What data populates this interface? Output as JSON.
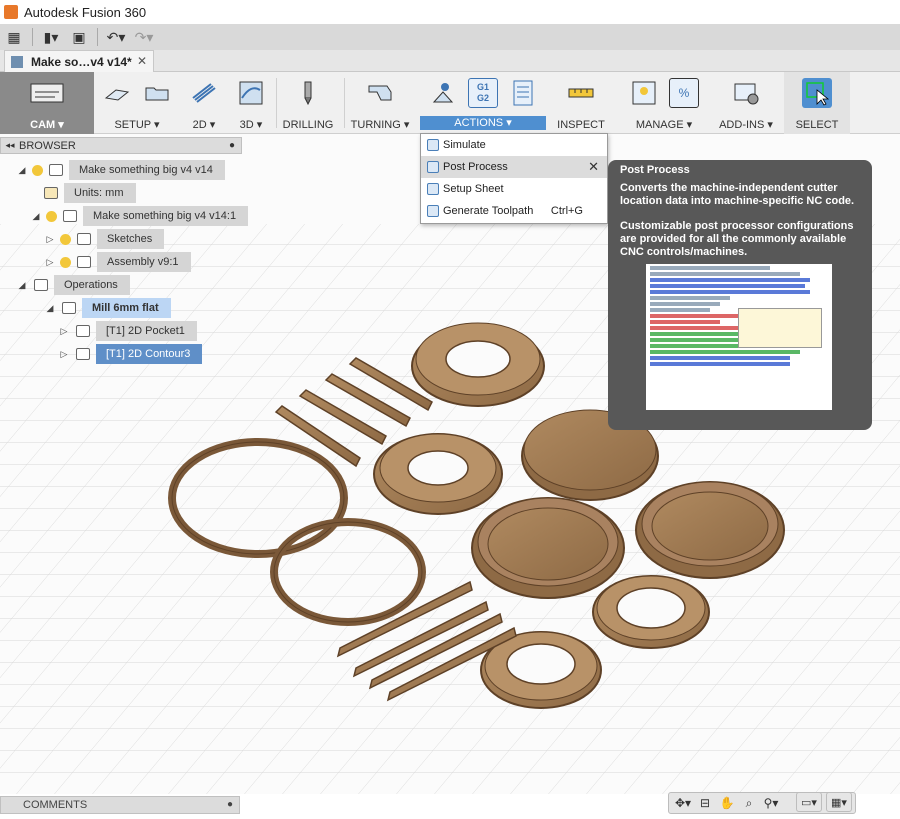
{
  "window": {
    "title": "Autodesk Fusion 360"
  },
  "qat": {
    "grid_icon": "grid-icon",
    "file_icon": "file-icon",
    "save_icon": "save-icon",
    "undo_icon": "undo-icon",
    "redo_icon": "redo-icon"
  },
  "document_tab": {
    "label": "Make so…v4 v14*",
    "close": "✕"
  },
  "toolbar": {
    "groups": [
      {
        "label": "CAM ▾"
      },
      {
        "label": "SETUP ▾"
      },
      {
        "label": "2D ▾"
      },
      {
        "label": "3D ▾"
      },
      {
        "label": "DRILLING"
      },
      {
        "label": "TURNING ▾"
      },
      {
        "label": "ACTIONS ▾"
      },
      {
        "label": "INSPECT"
      },
      {
        "label": "MANAGE ▾"
      },
      {
        "label": "ADD-INS ▾"
      },
      {
        "label": "SELECT"
      }
    ],
    "g1g2_text": [
      "G1",
      "G2"
    ],
    "percent_text": "%"
  },
  "browser": {
    "header": "BROWSER",
    "nodes": [
      {
        "label": "Make something big v4 v14"
      },
      {
        "label": "Units: mm"
      },
      {
        "label": "Make something big v4 v14:1"
      },
      {
        "label": "Sketches"
      },
      {
        "label": "Assembly v9:1"
      },
      {
        "label": "Operations"
      },
      {
        "label": "Mill 6mm flat"
      },
      {
        "label": "[T1] 2D Pocket1"
      },
      {
        "label": "[T1] 2D Contour3"
      }
    ]
  },
  "actions_menu": {
    "items": [
      {
        "label": "Simulate",
        "shortcut": ""
      },
      {
        "label": "Post Process",
        "shortcut": ""
      },
      {
        "label": "Setup Sheet",
        "shortcut": ""
      },
      {
        "label": "Generate Toolpath",
        "shortcut": "Ctrl+G"
      }
    ],
    "close": "✕"
  },
  "tooltip": {
    "title": "Post Process",
    "line1": "Converts the machine-independent cutter location data into machine-specific NC code.",
    "line2": "Customizable post processor configurations are provided for all the commonly available CNC controls/machines."
  },
  "comments": {
    "label": "COMMENTS"
  },
  "colors": {
    "wood": "#a07a52",
    "wood_edge": "#5e4127",
    "accent": "#4f8fd0",
    "tooltip_bg": "#585858"
  }
}
